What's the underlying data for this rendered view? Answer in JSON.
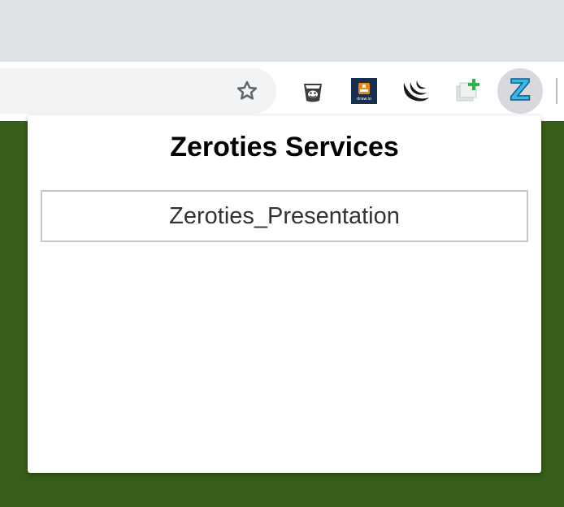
{
  "browser": {
    "toolbar": {
      "icons": {
        "bookmark": "star-outline",
        "extension_1": "bucket-icon",
        "extension_2": "drawio-icon",
        "extension_2_text": "draw.io",
        "extension_3": "jquery-icon",
        "extension_4": "add-page-icon",
        "extension_5": "z-extension-icon"
      },
      "z_extension_letter": "Z"
    }
  },
  "popup": {
    "title": "Zeroties Services",
    "services": [
      {
        "label": "Zeroties_Presentation"
      }
    ]
  },
  "colors": {
    "page_background": "#365e18",
    "tabstrip": "#dee1e6",
    "omnibox": "#f1f3f4",
    "z_accent": "#39b7e8"
  }
}
